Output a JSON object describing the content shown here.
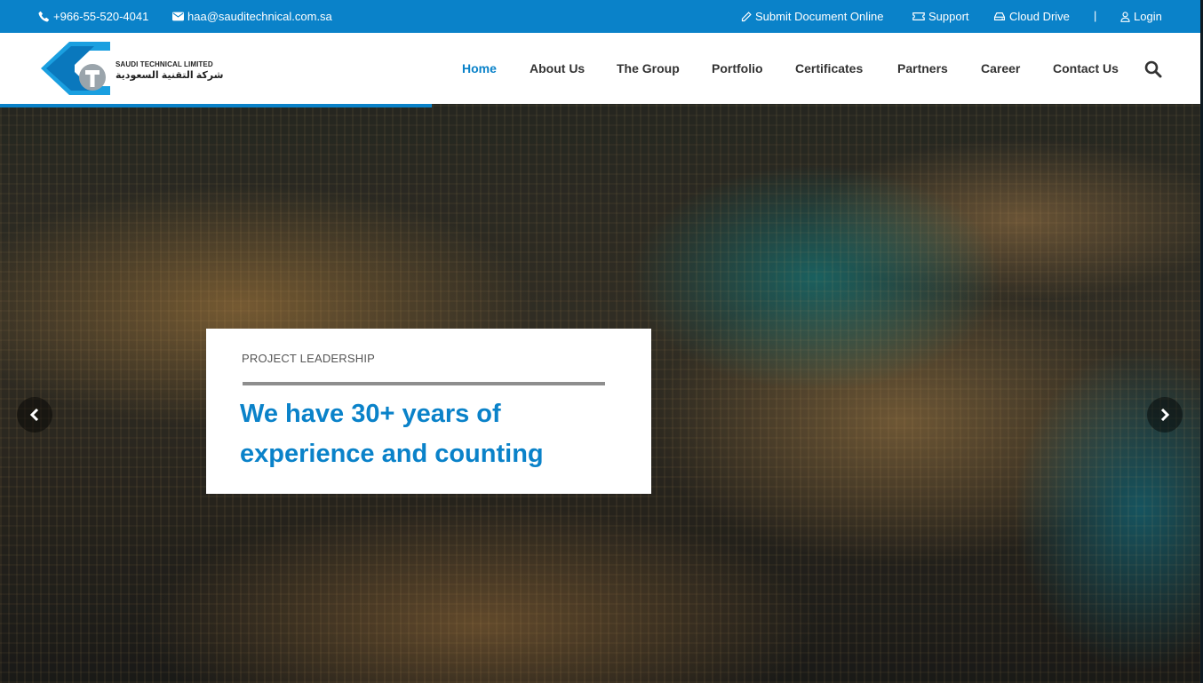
{
  "topbar": {
    "phone": "+966-55-520-4041",
    "email": "haa@sauditechnical.com.sa",
    "links": [
      {
        "label": "Submit Document Online",
        "icon": "pencil-icon"
      },
      {
        "label": "Support",
        "icon": "ticket-icon"
      },
      {
        "label": "Cloud Drive",
        "icon": "drive-icon"
      }
    ],
    "separator": "|",
    "login": "Login"
  },
  "brand": {
    "name_en": "SAUDI TECHNICAL LIMITED",
    "name_ar": "شركة التقنية السعودية",
    "logo_color": "#1a9fe0"
  },
  "nav": {
    "items": [
      {
        "label": "Home",
        "active": true
      },
      {
        "label": "About Us"
      },
      {
        "label": "The Group"
      },
      {
        "label": "Portfolio"
      },
      {
        "label": "Certificates"
      },
      {
        "label": "Partners"
      },
      {
        "label": "Career"
      },
      {
        "label": "Contact Us"
      }
    ]
  },
  "hero": {
    "subtitle": "PROJECT LEADERSHIP",
    "headline": "We have 30+ years of experience and counting",
    "slide_progress": 0.36
  },
  "colors": {
    "accent": "#0a82c9",
    "text": "#333333"
  }
}
